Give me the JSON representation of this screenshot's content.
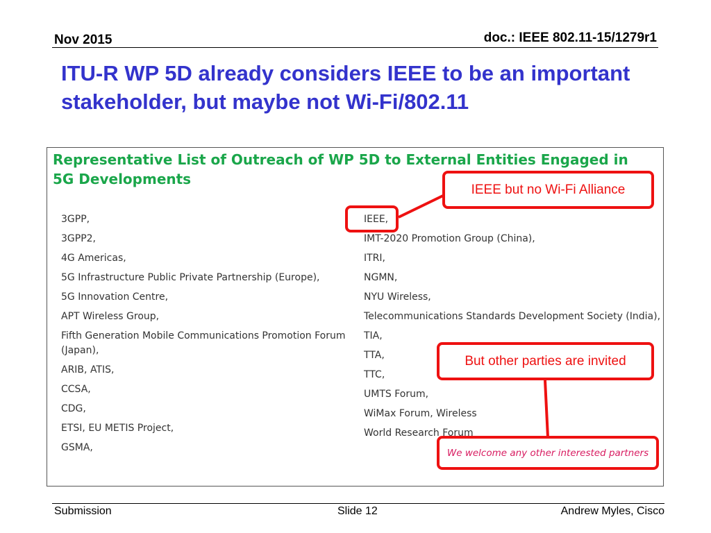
{
  "header": {
    "date": "Nov 2015",
    "doc_id": "doc.: IEEE 802.11-15/1279r1"
  },
  "slide": {
    "title": "ITU-R WP 5D already considers IEEE to be an important stakeholder, but maybe not Wi-Fi/802.11"
  },
  "panel": {
    "heading": "Representative List of Outreach of WP 5D to External Entities Engaged in 5G Developments",
    "left_column": [
      "3GPP,",
      "3GPP2,",
      "4G Americas,",
      "5G Infrastructure Public Private Partnership (Europe),",
      "5G Innovation Centre,",
      "APT Wireless Group,",
      "Fifth Generation Mobile Communications Promotion Forum (Japan),",
      "ARIB, ATIS,",
      "CCSA,",
      "CDG,",
      "ETSI, EU METIS Project,",
      "GSMA,"
    ],
    "right_column": [
      "IEEE,",
      "IMT-2020 Promotion Group (China),",
      "ITRI,",
      "NGMN,",
      "NYU Wireless,",
      "Telecommunications Standards Development Society (India),",
      "TIA,",
      "TTA,",
      "TTC,",
      "UMTS Forum,",
      "WiMax Forum, Wireless",
      "World Research Forum"
    ],
    "welcome_text": "We welcome any other interested partners"
  },
  "callouts": {
    "ieee_note": "IEEE but no Wi-Fi Alliance",
    "invited_note": "But other parties are invited",
    "color": "#ee1111"
  },
  "footer": {
    "left": "Submission",
    "center": "Slide 12",
    "right": "Andrew Myles, Cisco"
  },
  "colors": {
    "title": "#3333cc",
    "heading": "#1aa64a",
    "welcome": "#d81b60"
  }
}
